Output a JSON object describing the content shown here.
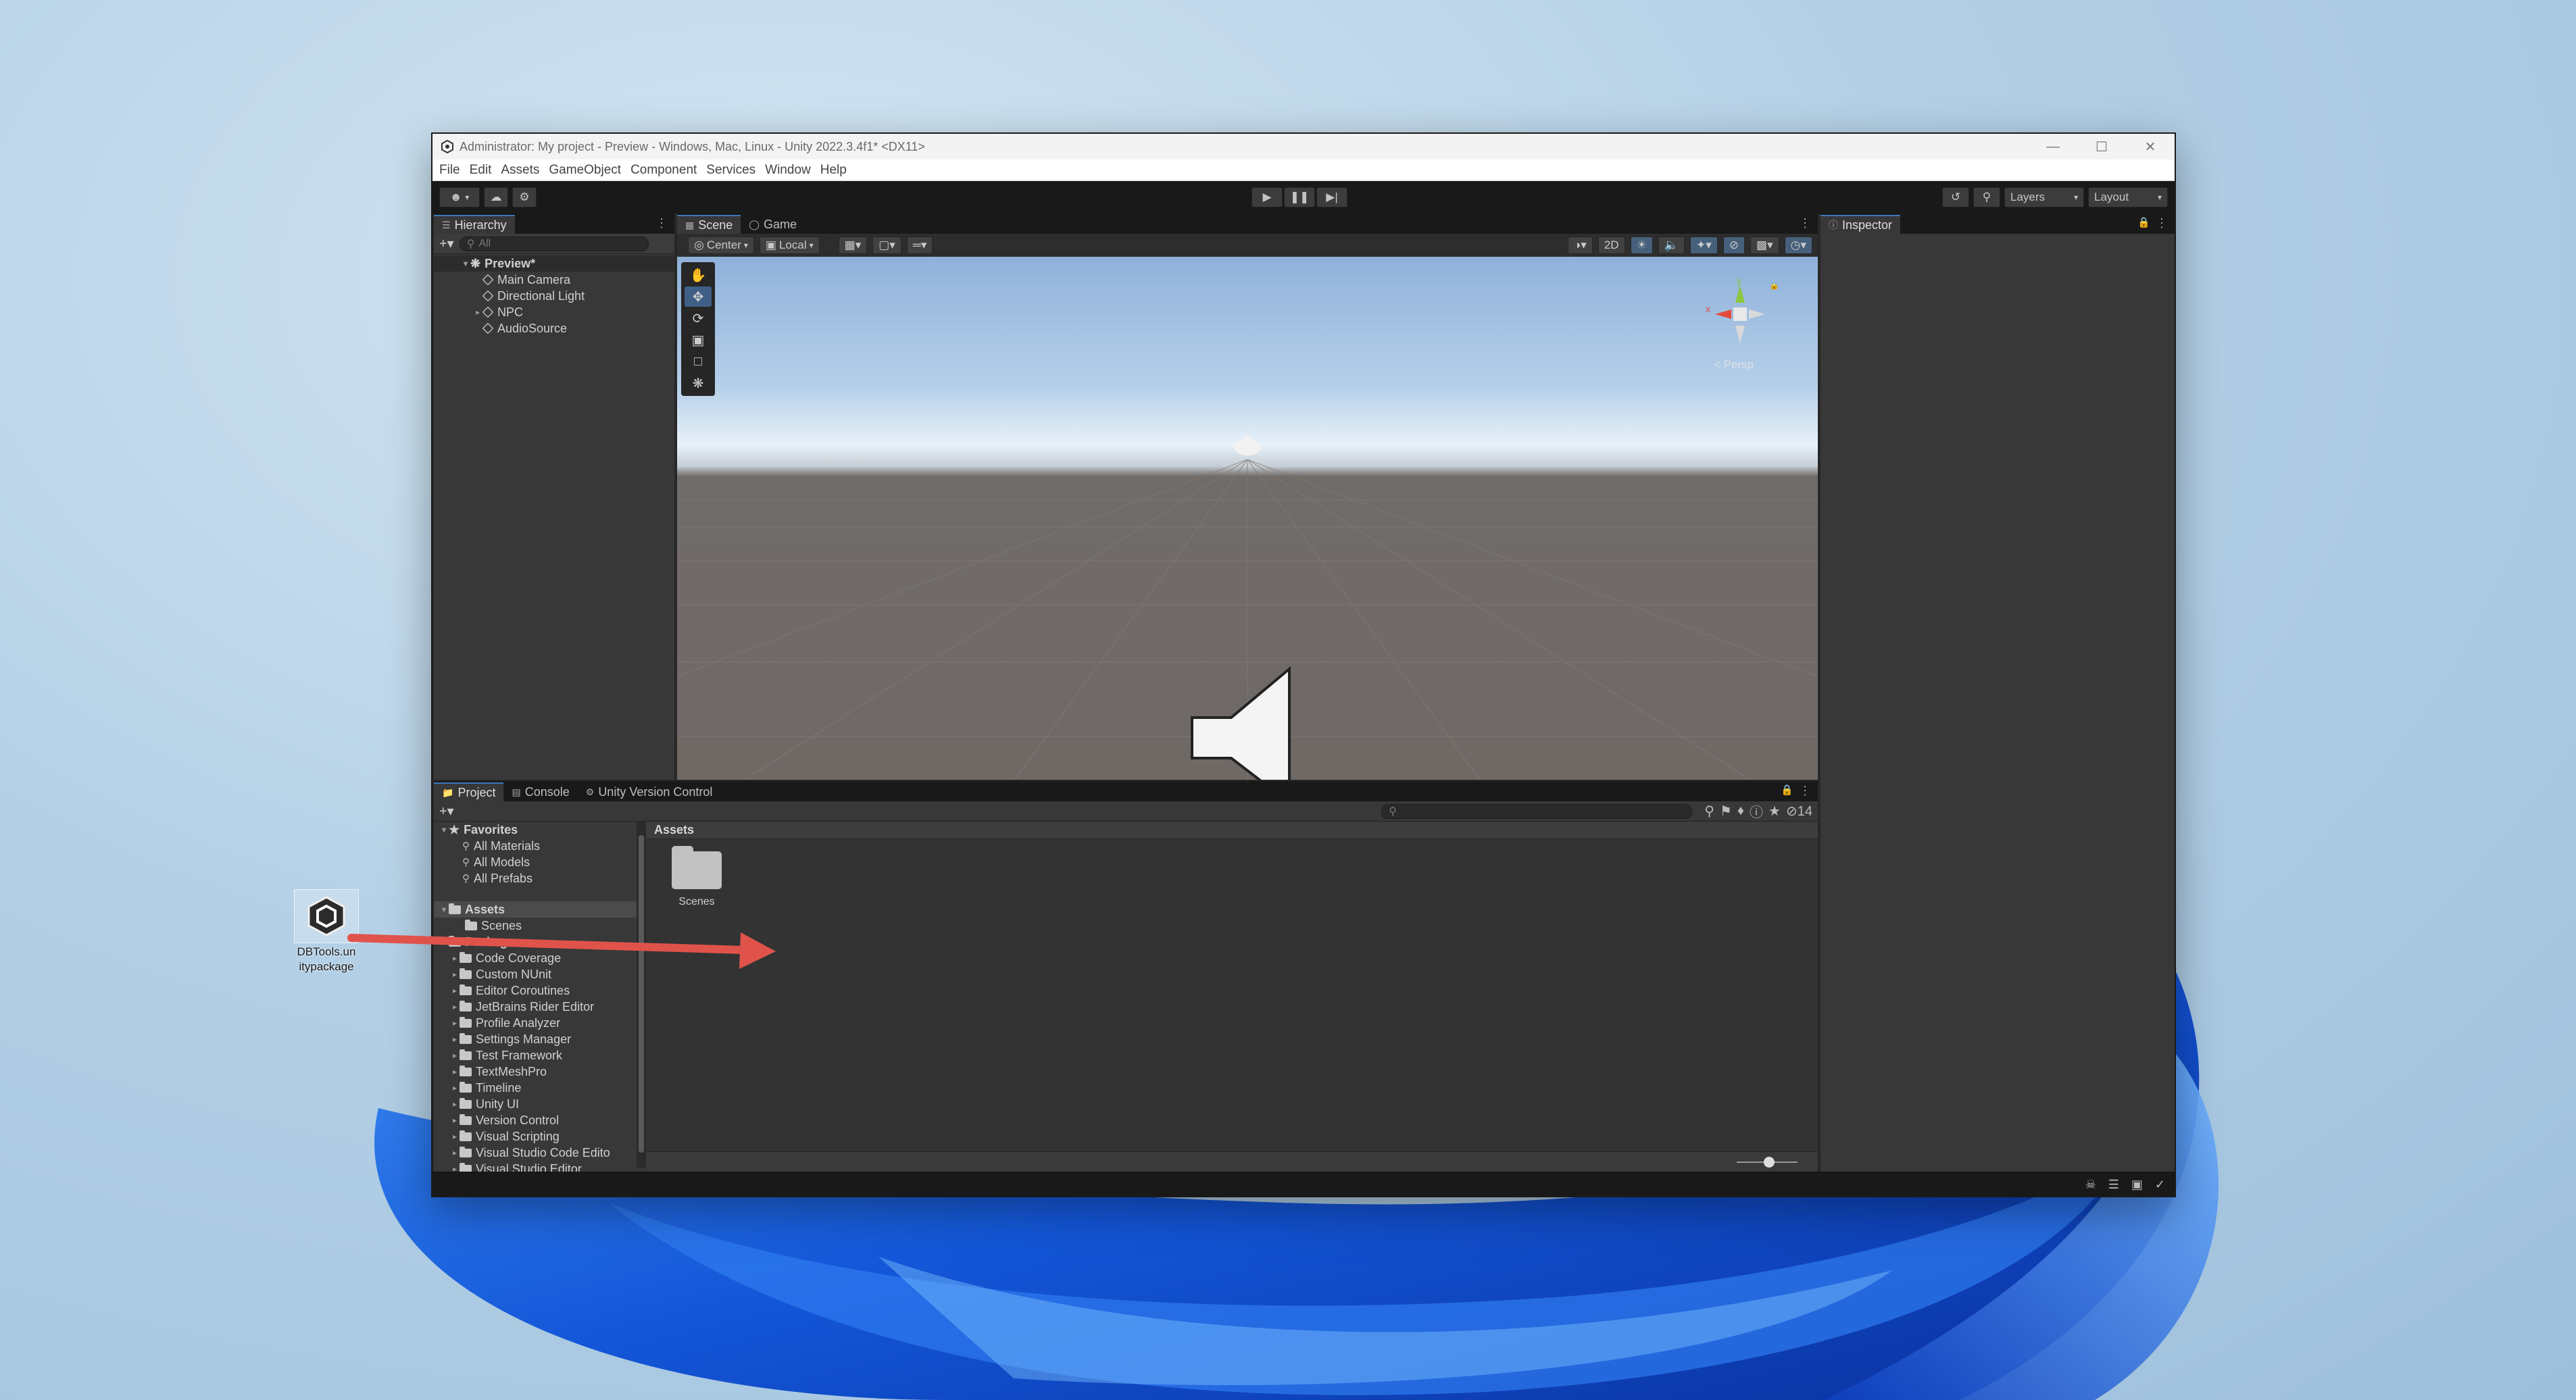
{
  "window": {
    "title": "Administrator: My project - Preview - Windows, Mac, Linux - Unity 2022.3.4f1* <DX11>"
  },
  "menu": [
    "File",
    "Edit",
    "Assets",
    "GameObject",
    "Component",
    "Services",
    "Window",
    "Help"
  ],
  "toolbar": {
    "layers_label": "Layers",
    "layout_label": "Layout"
  },
  "hierarchy": {
    "tab_label": "Hierarchy",
    "search_placeholder": "All",
    "scene_name": "Preview*",
    "objects": [
      "Main Camera",
      "Directional Light",
      "NPC",
      "AudioSource"
    ]
  },
  "scene": {
    "tab_scene": "Scene",
    "tab_game": "Game",
    "pivot_label": "Center",
    "space_label": "Local",
    "mode_2d": "2D",
    "persp_label": "< Persp",
    "gizmo_x": "x",
    "gizmo_y": "y"
  },
  "project": {
    "tab_project": "Project",
    "tab_console": "Console",
    "tab_vc": "Unity Version Control",
    "hidden_count": "14",
    "favorites_label": "Favorites",
    "favorites": [
      "All Materials",
      "All Models",
      "All Prefabs"
    ],
    "assets_label": "Assets",
    "asset_children": [
      "Scenes",
      "Packages"
    ],
    "packages": [
      "Code Coverage",
      "Custom NUnit",
      "Editor Coroutines",
      "JetBrains Rider Editor",
      "Profile Analyzer",
      "Settings Manager",
      "Test Framework",
      "TextMeshPro",
      "Timeline",
      "Unity UI",
      "Version Control",
      "Visual Scripting",
      "Visual Studio Code Edito",
      "Visual Studio Editor"
    ],
    "breadcrumb": "Assets",
    "grid_items": [
      "Scenes"
    ]
  },
  "inspector": {
    "tab_label": "Inspector"
  },
  "desktop": {
    "icon_label_line1": "DBTools.un",
    "icon_label_line2": "itypackage"
  },
  "colors": {
    "arrow": "#e0534b",
    "tab_active_border": "#3a79bb",
    "panel_bg": "#383838"
  }
}
